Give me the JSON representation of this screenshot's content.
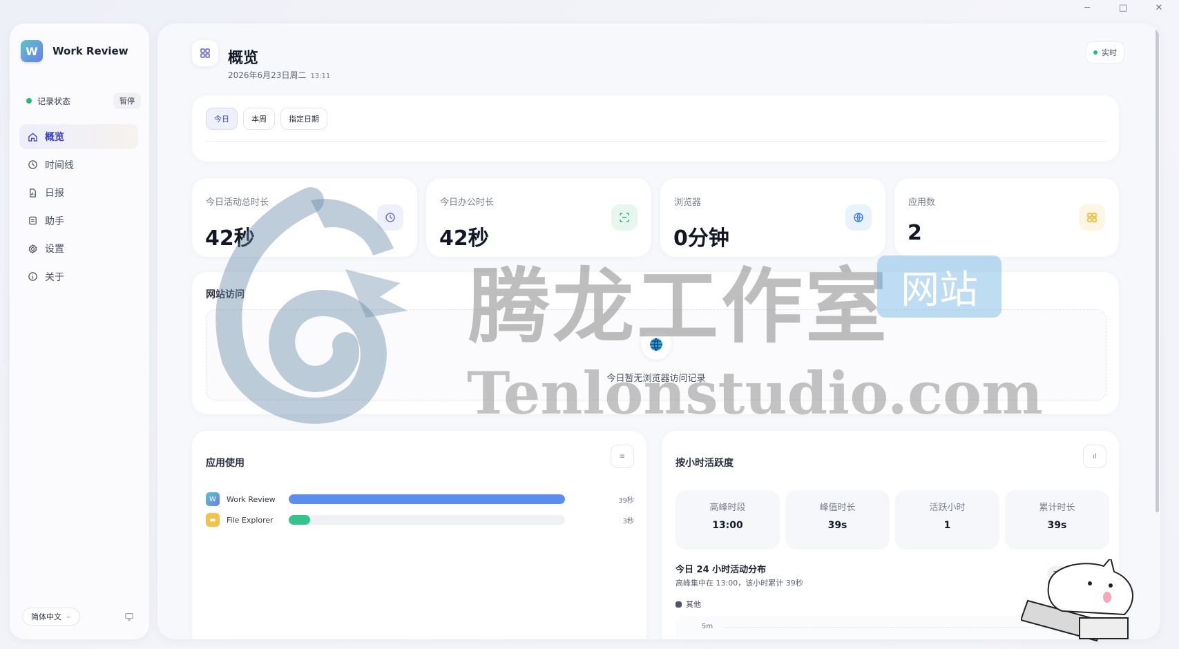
{
  "window": {
    "minimize": "─",
    "maximize": "□",
    "close": "✕"
  },
  "brand": {
    "name": "Work Review",
    "logo_letter": "W"
  },
  "record": {
    "label": "记录状态",
    "pause_label": "暂停",
    "status_color": "#1fbf73"
  },
  "nav": {
    "items": [
      {
        "label": "概览",
        "icon": "home-icon",
        "active": true
      },
      {
        "label": "时间线",
        "icon": "clock-icon"
      },
      {
        "label": "日报",
        "icon": "document-icon"
      },
      {
        "label": "助手",
        "icon": "assistant-icon"
      },
      {
        "label": "设置",
        "icon": "gear-icon"
      },
      {
        "label": "关于",
        "icon": "info-icon"
      }
    ]
  },
  "footer": {
    "language": "简体中文"
  },
  "header": {
    "title": "概览",
    "date": "2026年6月23日周二",
    "time": "13:11",
    "live_label": "实时"
  },
  "tabs": [
    "今日",
    "本周",
    "指定日期"
  ],
  "stats": [
    {
      "label": "今日活动总时长",
      "value": "42秒",
      "icon": "clock-icon",
      "color": "#6c72d8",
      "bg": "#eef0fb"
    },
    {
      "label": "今日办公时长",
      "value": "42秒",
      "icon": "scan-icon",
      "color": "#27b37c",
      "bg": "#e7f7ef"
    },
    {
      "label": "浏览器",
      "value": "0分钟",
      "icon": "globe-icon",
      "color": "#3b82f6",
      "bg": "#eaf2fd"
    },
    {
      "label": "应用数",
      "value": "2",
      "icon": "grid-icon",
      "color": "#f0b429",
      "bg": "#fdf6e3"
    }
  ],
  "websites": {
    "title": "网站访问",
    "empty_text": "今日暂无浏览器访问记录"
  },
  "apps": {
    "title": "应用使用",
    "items": [
      {
        "name": "Work Review",
        "value": "39秒",
        "fraction": 1.0,
        "color": "#5b8def"
      },
      {
        "name": "File Explorer",
        "value": "3秒",
        "fraction": 0.077,
        "color": "#34c38f"
      }
    ]
  },
  "hourly": {
    "title": "按小时活跃度",
    "metrics": [
      {
        "label": "高峰时段",
        "value": "13:00"
      },
      {
        "label": "峰值时长",
        "value": "39s"
      },
      {
        "label": "活跃小时",
        "value": "1"
      },
      {
        "label": "累计时长",
        "value": "39s"
      }
    ],
    "dist_title": "今日 24 小时活动分布",
    "dist_sub": "高峰集中在 13:00，该小时累计 39秒",
    "top_badge": "TOP 1 · 13:00",
    "legend": "其他",
    "y_label": "5m"
  },
  "watermark": {
    "cn": "腾龙工作室",
    "badge": "网站",
    "en": "Tenlonstudio.com"
  }
}
